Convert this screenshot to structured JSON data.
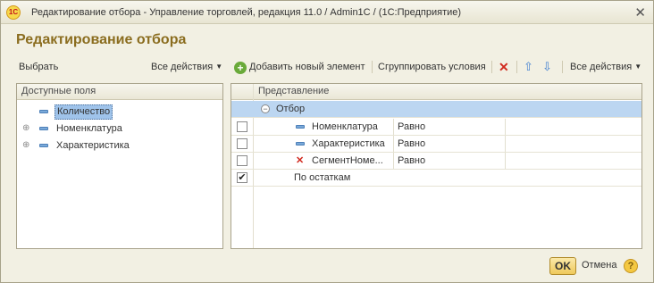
{
  "window": {
    "title": "Редактирование отбора - Управление торговлей, редакция 11.0 / Admin1C /  (1С:Предприятие)",
    "logo_text": "1С",
    "close_symbol": "✕"
  },
  "heading": "Редактирование отбора",
  "left_toolbar": {
    "select_label": "Выбрать",
    "all_actions_label": "Все действия"
  },
  "right_toolbar": {
    "add_element_label": "Добавить новый элемент",
    "group_conditions_label": "Сгруппировать условия",
    "all_actions_label": "Все действия",
    "delete_icon": "✕",
    "up_icon": "⇧",
    "down_icon": "⇩"
  },
  "available_fields": {
    "header": "Доступные поля",
    "items": [
      {
        "label": "Количество",
        "expandable": false,
        "selected": true
      },
      {
        "label": "Номенклатура",
        "expandable": true,
        "selected": false
      },
      {
        "label": "Характеристика",
        "expandable": true,
        "selected": false
      }
    ]
  },
  "filter_table": {
    "header": "Представление",
    "group": {
      "label": "Отбор",
      "collapse_symbol": "⊖"
    },
    "rows": [
      {
        "checked": false,
        "field": "Номенклатура",
        "condition": "Равно",
        "icon": "field"
      },
      {
        "checked": false,
        "field": "Характеристика",
        "condition": "Равно",
        "icon": "field"
      },
      {
        "checked": false,
        "field": "СегментНоме...",
        "condition": "Равно",
        "icon": "invalid"
      },
      {
        "checked": true,
        "field": "По остаткам",
        "condition": "",
        "icon": "none"
      }
    ],
    "check_mark": "✔"
  },
  "footer": {
    "ok_label": "OK",
    "cancel_label": "Отмена",
    "help_symbol": "?"
  },
  "colors": {
    "heading": "#8b6d1f",
    "selection": "#bcd6f1",
    "ok_button": "#efc95b"
  }
}
